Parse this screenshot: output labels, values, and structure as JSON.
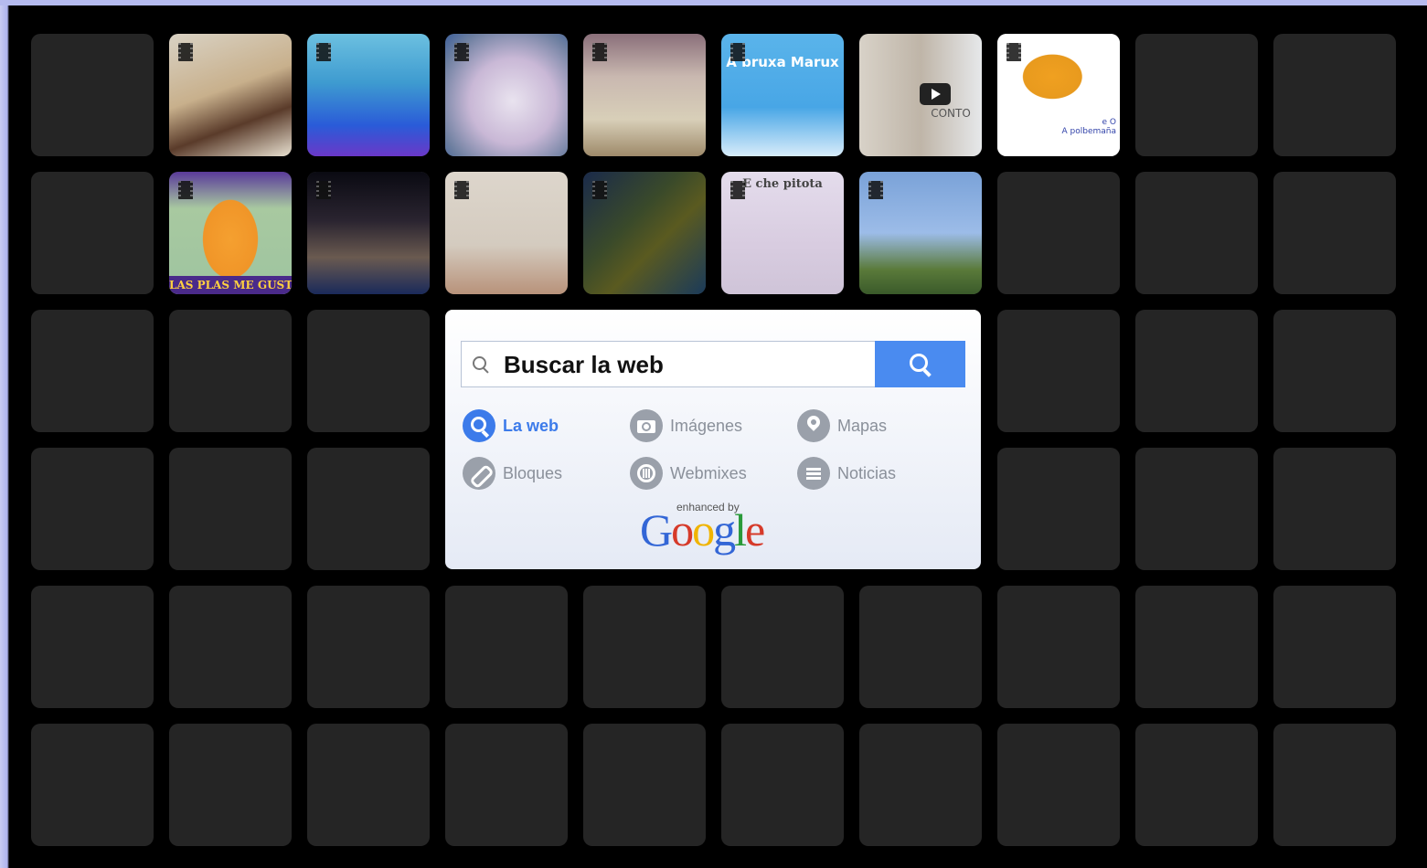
{
  "thumbnails": [
    {
      "caption": "",
      "video": false
    },
    {
      "caption": "",
      "video": false
    },
    {
      "caption": "",
      "video": false
    },
    {
      "caption": "",
      "video": false
    },
    {
      "caption": "A bruxa Marux",
      "video": false
    },
    {
      "caption": "CONTO",
      "video": true
    },
    {
      "caption": "e O\nA polbemaña",
      "video": false
    },
    {
      "caption": "LAS PLAS ME GUSTA C",
      "video": false
    },
    {
      "caption": "",
      "video": false
    },
    {
      "caption": "",
      "video": false
    },
    {
      "caption": "",
      "video": false
    },
    {
      "caption": "E che pitota",
      "video": false
    },
    {
      "caption": "",
      "video": false
    }
  ],
  "search": {
    "placeholder": "Buscar la web",
    "options": [
      {
        "label": "La web",
        "icon": "search-icon",
        "active": true
      },
      {
        "label": "Imágenes",
        "icon": "camera-icon",
        "active": false
      },
      {
        "label": "Mapas",
        "icon": "map-pin-icon",
        "active": false
      },
      {
        "label": "Bloques",
        "icon": "link-icon",
        "active": false
      },
      {
        "label": "Webmixes",
        "icon": "webmix-icon",
        "active": false
      },
      {
        "label": "Noticias",
        "icon": "news-icon",
        "active": false
      }
    ],
    "branding_small": "enhanced by",
    "branding_word": "Google"
  },
  "colors": {
    "tile_empty": "#252525",
    "board": "#000000",
    "accent": "#4a8bf0"
  }
}
